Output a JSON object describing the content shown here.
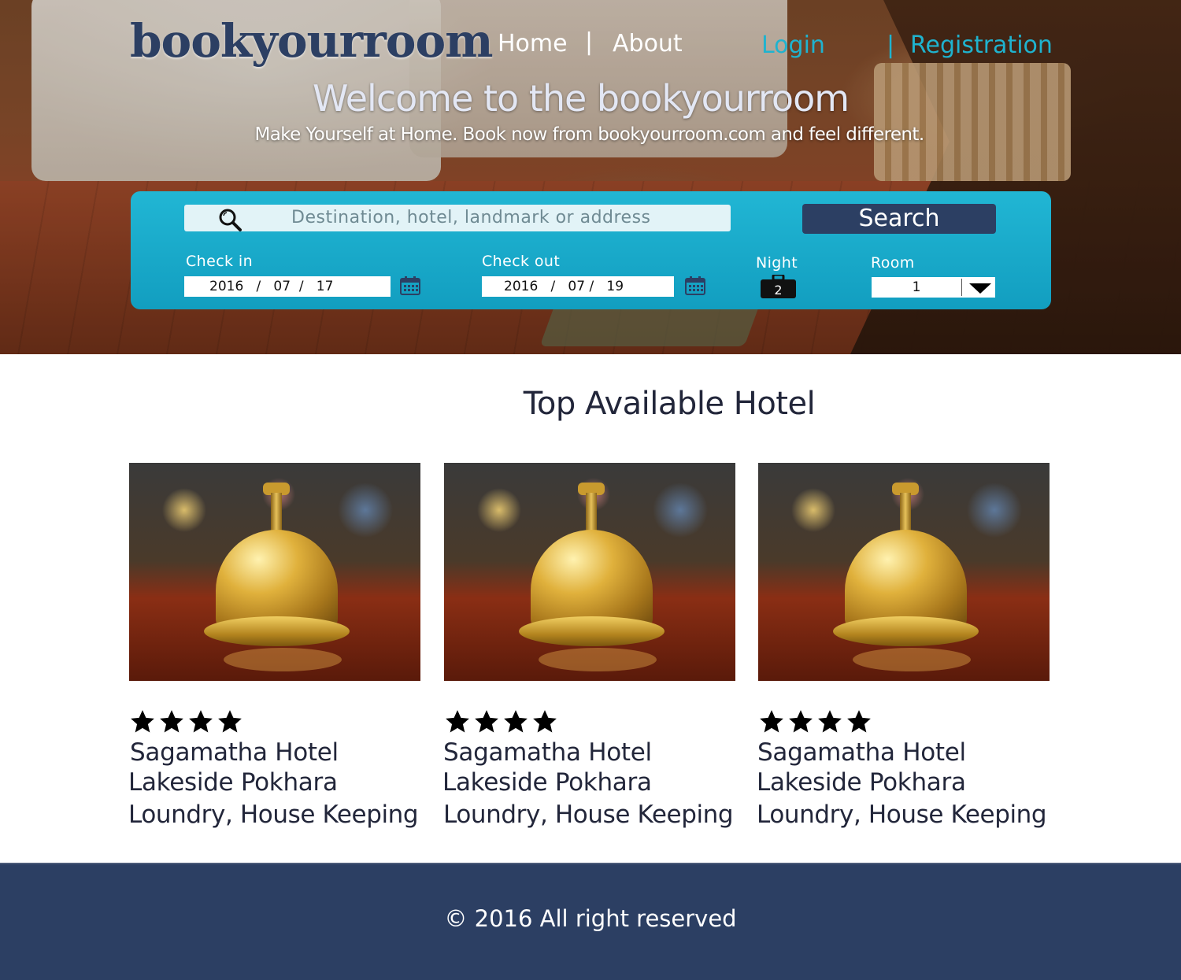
{
  "brand": {
    "logo": "bookyourroom"
  },
  "nav": {
    "home": "Home",
    "separator": "|",
    "about": "About",
    "login": "Login",
    "registration": "Registration"
  },
  "hero": {
    "title": "Welcome to the bookyourroom",
    "subtitle": "Make Yourself at Home. Book now from bookyourroom.com and feel different."
  },
  "search": {
    "placeholder": "Destination, hotel, landmark or address",
    "button": "Search",
    "checkin_label": "Check in",
    "checkin_value": "2016   /   07  /   17",
    "checkout_label": "Check out",
    "checkout_value": "2016   /   07 /   19",
    "night_label": "Night",
    "night_value": "2",
    "room_label": "Room",
    "room_value": "1"
  },
  "section": {
    "title": "Top Available Hotel"
  },
  "hotels": [
    {
      "rating": 4,
      "name": "Sagamatha Hotel",
      "location": "Lakeside Pokhara",
      "amenities": "Loundry, House Keeping"
    },
    {
      "rating": 4,
      "name": "Sagamatha Hotel",
      "location": "Lakeside Pokhara",
      "amenities": "Loundry, House Keeping"
    },
    {
      "rating": 4,
      "name": "Sagamatha Hotel",
      "location": "Lakeside Pokhara",
      "amenities": "Loundry, House Keeping"
    }
  ],
  "footer": {
    "copyright": "© 2016 All right reserved"
  },
  "icons": {
    "search": "search-icon",
    "calendar": "calendar-icon",
    "night": "suitcase-icon",
    "dropdown": "chevron-down-icon",
    "star": "star-icon"
  },
  "colors": {
    "brand_navy": "#2c3f63",
    "panel_cyan": "#1aaecf",
    "link_cyan": "#1fb3cf",
    "text_dark": "#22263a"
  }
}
